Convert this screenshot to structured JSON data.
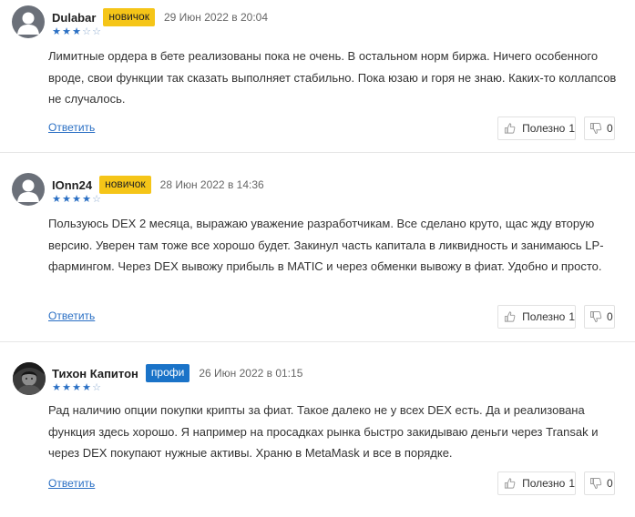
{
  "reviews": [
    {
      "author": "Dulabar",
      "badge": "новичок",
      "date": "29 Июн 2022 в 20:04",
      "rating": 3,
      "text": "Лимитные ордера в бете реализованы пока не очень. В остальном норм биржа. Ничего особенного вроде, свои функции так сказать выполняет стабильно. Пока юзаю и горя не знаю. Каких-то коллапсов не случалось.",
      "reply_label": "Ответить",
      "useful_label": "Полезно",
      "useful_count": "1",
      "not_useful_count": "0"
    },
    {
      "author": "IOnn24",
      "badge": "новичок",
      "date": "28 Июн 2022 в 14:36",
      "rating": 4,
      "text": "Пользуюсь DEX 2 месяца, выражаю уважение разработчикам. Все сделано круто, щас жду вторую версию. Уверен там тоже все хорошо будет. Закинул часть капитала в ликвидность и занимаюсь LP-фармингом. Через DEX вывожу прибыль в MATIC и через обменки вывожу в фиат. Удобно и просто.",
      "reply_label": "Ответить",
      "useful_label": "Полезно",
      "useful_count": "1",
      "not_useful_count": "0"
    },
    {
      "author": "Тихон Капитон",
      "badge": "профи",
      "date": "26 Июн 2022 в 01:15",
      "rating": 4,
      "text": "Рад наличию опции покупки крипты за фиат. Такое далеко не у всех DEX есть. Да и реализована функция здесь хорошо. Я например на просадках рынка быстро закидываю деньги через Transak и через DEX покупают нужные активы. Храню в MetaMask и все в порядке.",
      "reply_label": "Ответить",
      "useful_label": "Полезно",
      "useful_count": "1",
      "not_useful_count": "0"
    }
  ],
  "colors": {
    "badge_novice": "#f5c518",
    "badge_pro": "#1a73c8",
    "star_active": "#2a6fc4",
    "link": "#2a6fc4"
  },
  "icons": {
    "avatar_default": "user-silhouette-icon",
    "thumb_up": "thumbs-up-icon",
    "thumb_down": "thumbs-down-icon",
    "star": "star-icon"
  }
}
